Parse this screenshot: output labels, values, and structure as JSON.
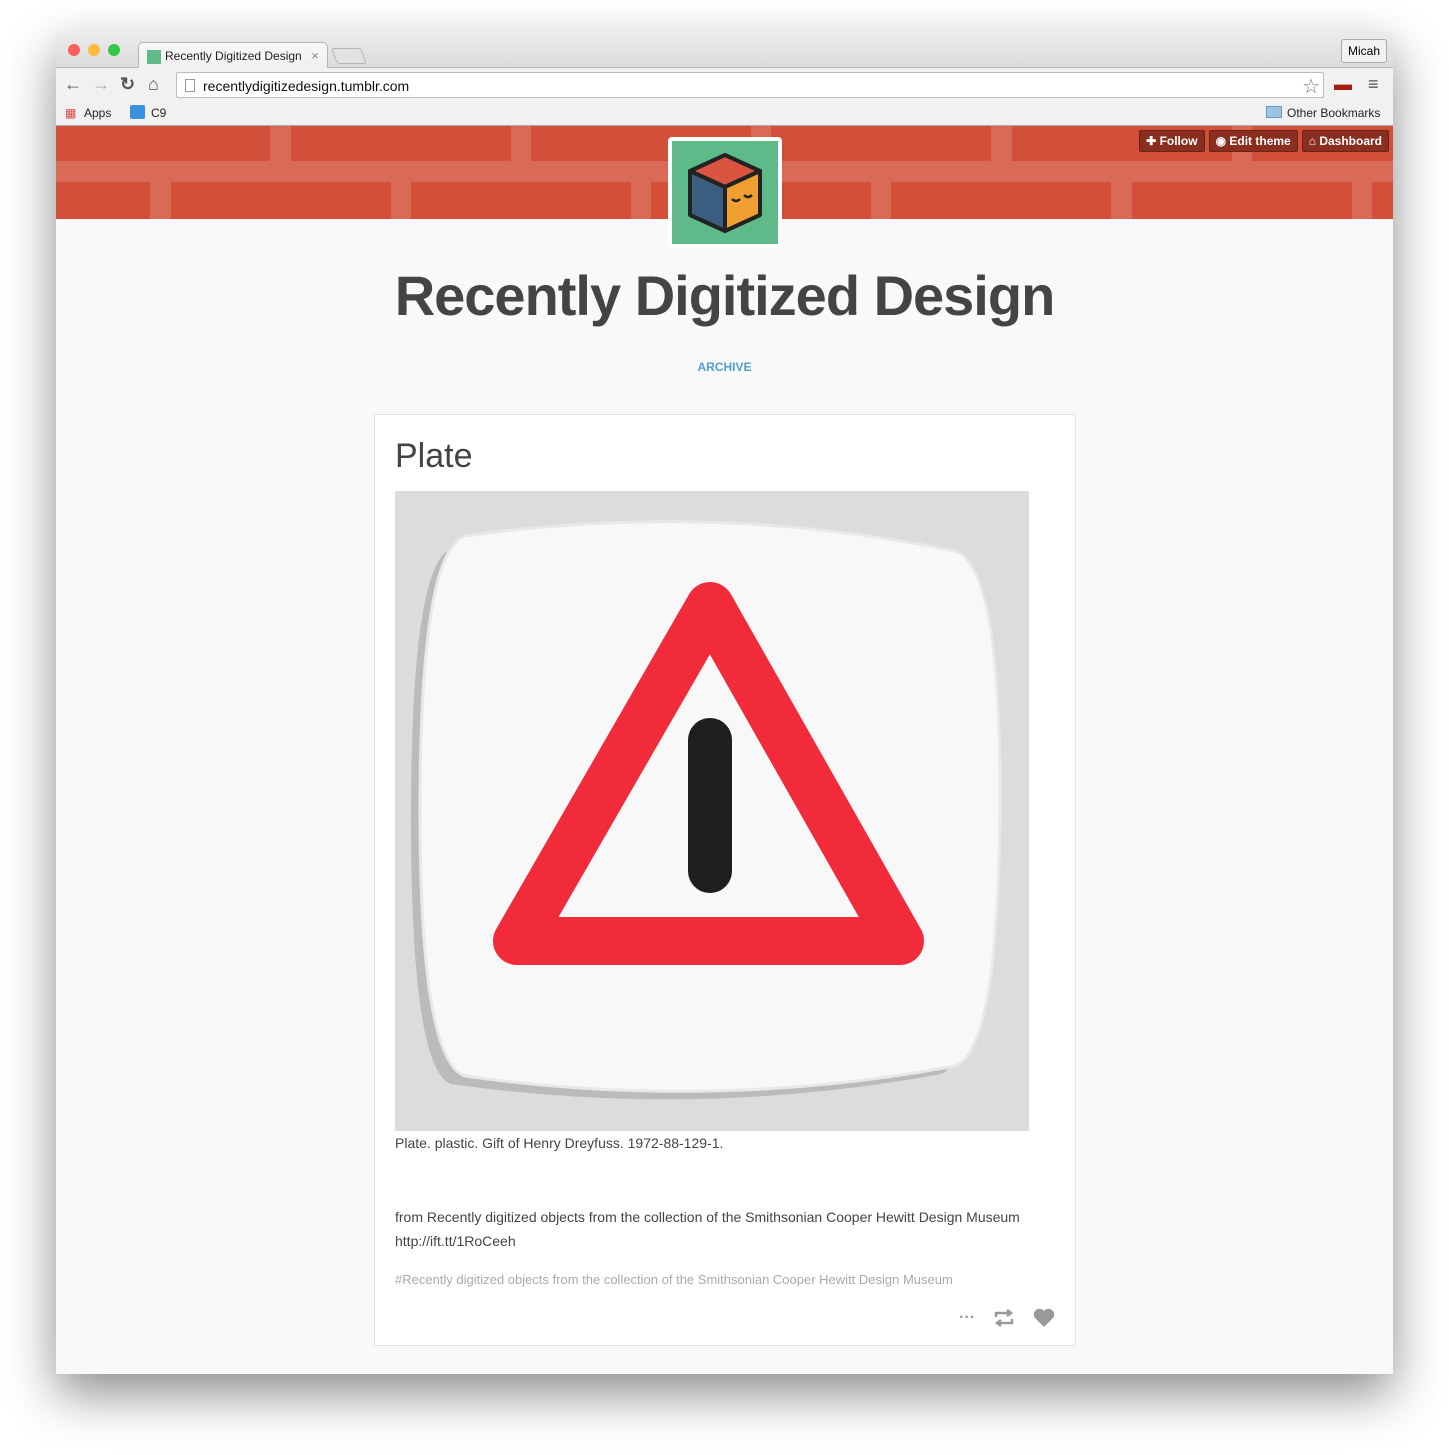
{
  "browser": {
    "tab_title": "Recently Digitized Design",
    "tab_close": "×",
    "profile": "Micah",
    "url": "recentlydigitizedesign.tumblr.com",
    "bookmarks": [
      {
        "label": "Apps"
      },
      {
        "label": "C9"
      }
    ],
    "other_bookmarks": "Other Bookmarks"
  },
  "controls": {
    "follow": "Follow",
    "edit_theme": "Edit theme",
    "dashboard": "Dashboard"
  },
  "colors": {
    "header": "#d2503a",
    "avatar": "#5fba8a",
    "link": "#529ecc"
  },
  "blog": {
    "title": "Recently Digitized Design",
    "archive": "ARCHIVE"
  },
  "post": {
    "title": "Plate",
    "caption": "Plate. plastic. Gift of Henry Dreyfuss. 1972-88-129-1.",
    "source_text": "from Recently digitized objects from the collection of the Smithsonian Cooper Hewitt Design Museum",
    "source_link": "http://ift.tt/1RoCeeh",
    "tag": "#Recently digitized objects from the collection of the Smithsonian Cooper Hewitt Design Museum",
    "more": "···"
  }
}
